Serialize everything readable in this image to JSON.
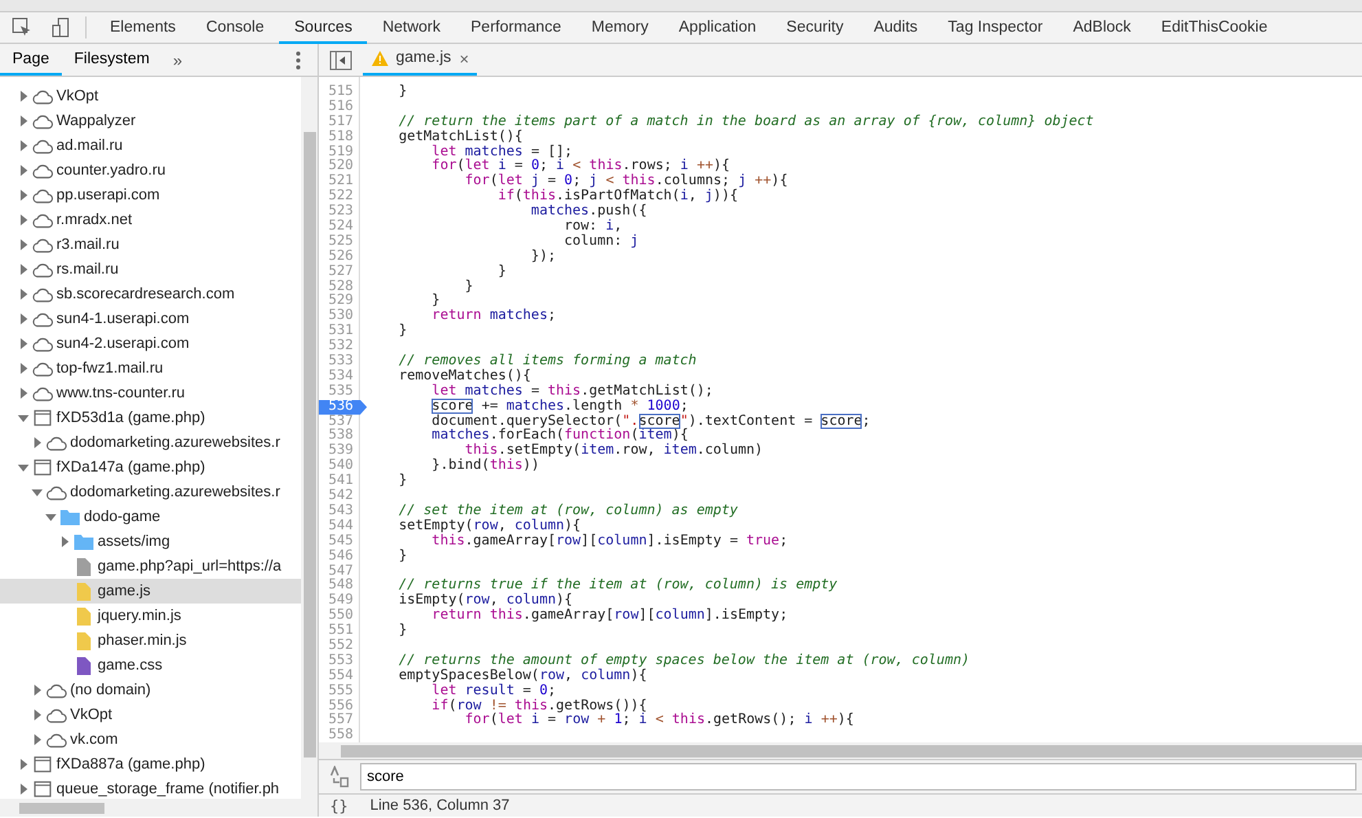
{
  "panel_tabs": [
    {
      "label": "Elements",
      "selected": false
    },
    {
      "label": "Console",
      "selected": false
    },
    {
      "label": "Sources",
      "selected": true
    },
    {
      "label": "Network",
      "selected": false
    },
    {
      "label": "Performance",
      "selected": false
    },
    {
      "label": "Memory",
      "selected": false
    },
    {
      "label": "Application",
      "selected": false
    },
    {
      "label": "Security",
      "selected": false
    },
    {
      "label": "Audits",
      "selected": false
    },
    {
      "label": "Tag Inspector",
      "selected": false
    },
    {
      "label": "AdBlock",
      "selected": false
    },
    {
      "label": "EditThisCookie",
      "selected": false
    }
  ],
  "navigator": {
    "tabs": [
      {
        "label": "Page",
        "selected": true
      },
      {
        "label": "Filesystem",
        "selected": false
      }
    ],
    "more": "»",
    "tree": [
      {
        "kind": "cloud",
        "label": "VkOpt",
        "expanded": false,
        "selected": false
      },
      {
        "kind": "cloud",
        "label": "Wappalyzer",
        "expanded": false,
        "selected": false
      },
      {
        "kind": "cloud",
        "label": "ad.mail.ru",
        "expanded": false,
        "selected": false
      },
      {
        "kind": "cloud",
        "label": "counter.yadro.ru",
        "expanded": false,
        "selected": false
      },
      {
        "kind": "cloud",
        "label": "pp.userapi.com",
        "expanded": false,
        "selected": false
      },
      {
        "kind": "cloud",
        "label": "r.mradx.net",
        "expanded": false,
        "selected": false
      },
      {
        "kind": "cloud",
        "label": "r3.mail.ru",
        "expanded": false,
        "selected": false
      },
      {
        "kind": "cloud",
        "label": "rs.mail.ru",
        "expanded": false,
        "selected": false
      },
      {
        "kind": "cloud",
        "label": "sb.scorecardresearch.com",
        "expanded": false,
        "selected": false
      },
      {
        "kind": "cloud",
        "label": "sun4-1.userapi.com",
        "expanded": false,
        "selected": false
      },
      {
        "kind": "cloud",
        "label": "sun4-2.userapi.com",
        "expanded": false,
        "selected": false
      },
      {
        "kind": "cloud",
        "label": "top-fwz1.mail.ru",
        "expanded": false,
        "selected": false
      },
      {
        "kind": "cloud",
        "label": "www.tns-counter.ru",
        "expanded": false,
        "selected": false
      },
      {
        "kind": "frame",
        "label": "fXD53d1a (game.php)",
        "expanded": true,
        "selected": false,
        "children": [
          {
            "kind": "cloud",
            "label": "dodomarketing.azurewebsites.r",
            "expanded": false,
            "selected": false
          }
        ]
      },
      {
        "kind": "frame",
        "label": "fXDa147a (game.php)",
        "expanded": true,
        "selected": false,
        "children": [
          {
            "kind": "cloud",
            "label": "dodomarketing.azurewebsites.r",
            "expanded": true,
            "selected": false,
            "children": [
              {
                "kind": "folder",
                "label": "dodo-game",
                "expanded": true,
                "selected": false,
                "children": [
                  {
                    "kind": "folder",
                    "label": "assets/img",
                    "expanded": false,
                    "selected": false
                  },
                  {
                    "kind": "file",
                    "label": "game.php?api_url=https://a",
                    "color": "#9e9e9e",
                    "selected": false
                  },
                  {
                    "kind": "file",
                    "label": "game.js",
                    "color": "#f0c94b",
                    "selected": true
                  },
                  {
                    "kind": "file",
                    "label": "jquery.min.js",
                    "color": "#f0c94b",
                    "selected": false
                  },
                  {
                    "kind": "file",
                    "label": "phaser.min.js",
                    "color": "#f0c94b",
                    "selected": false
                  },
                  {
                    "kind": "file",
                    "label": "game.css",
                    "color": "#7e57c2",
                    "selected": false
                  }
                ]
              }
            ]
          },
          {
            "kind": "cloud",
            "label": "(no domain)",
            "expanded": false,
            "selected": false
          },
          {
            "kind": "cloud",
            "label": "VkOpt",
            "expanded": false,
            "selected": false
          },
          {
            "kind": "cloud",
            "label": "vk.com",
            "expanded": false,
            "selected": false
          }
        ]
      },
      {
        "kind": "frame",
        "label": "fXDa887a (game.php)",
        "expanded": false,
        "selected": false
      },
      {
        "kind": "frame",
        "label": "queue_storage_frame (notifier.ph",
        "expanded": false,
        "selected": false
      }
    ]
  },
  "editor": {
    "tab": {
      "label": "game.js",
      "close": "×"
    },
    "lines": [
      {
        "number": "515",
        "breakpoint": false,
        "tokens": [
          {
            "kind": "plain",
            "text": "    }"
          }
        ]
      },
      {
        "number": "516",
        "breakpoint": false
      },
      {
        "number": "517",
        "breakpoint": false,
        "tokens": [
          {
            "kind": "comment",
            "text": "    // return the items part of a match in the board as an array of {row, column} object"
          }
        ]
      },
      {
        "number": "518",
        "breakpoint": false,
        "tokens": [
          {
            "kind": "plain",
            "text": "    getMatchList(){"
          }
        ]
      },
      {
        "number": "519",
        "breakpoint": false,
        "tokens": [
          {
            "kind": "keyword",
            "text": "        let"
          },
          {
            "kind": "variable",
            "text": " matches"
          },
          {
            "kind": "plain",
            "text": " = [];"
          }
        ]
      },
      {
        "number": "520",
        "breakpoint": false,
        "tokens": [
          {
            "kind": "keyword",
            "text": "        for"
          },
          {
            "kind": "plain",
            "text": "("
          },
          {
            "kind": "keyword",
            "text": "let"
          },
          {
            "kind": "variable",
            "text": " i"
          },
          {
            "kind": "plain",
            "text": " = "
          },
          {
            "kind": "number",
            "text": "0"
          },
          {
            "kind": "plain",
            "text": "; "
          },
          {
            "kind": "variable",
            "text": "i"
          },
          {
            "kind": "operator",
            "text": " <"
          },
          {
            "kind": "keyword",
            "text": " this"
          },
          {
            "kind": "plain",
            "text": ".rows; "
          },
          {
            "kind": "variable",
            "text": "i"
          },
          {
            "kind": "operator",
            "text": " ++"
          },
          {
            "kind": "plain",
            "text": "){"
          }
        ]
      },
      {
        "number": "521",
        "breakpoint": false,
        "tokens": [
          {
            "kind": "keyword",
            "text": "            for"
          },
          {
            "kind": "plain",
            "text": "("
          },
          {
            "kind": "keyword",
            "text": "let"
          },
          {
            "kind": "variable",
            "text": " j"
          },
          {
            "kind": "plain",
            "text": " = "
          },
          {
            "kind": "number",
            "text": "0"
          },
          {
            "kind": "plain",
            "text": "; "
          },
          {
            "kind": "variable",
            "text": "j"
          },
          {
            "kind": "operator",
            "text": " <"
          },
          {
            "kind": "keyword",
            "text": " this"
          },
          {
            "kind": "plain",
            "text": ".columns; "
          },
          {
            "kind": "variable",
            "text": "j"
          },
          {
            "kind": "operator",
            "text": " ++"
          },
          {
            "kind": "plain",
            "text": "){"
          }
        ]
      },
      {
        "number": "522",
        "breakpoint": false,
        "tokens": [
          {
            "kind": "keyword",
            "text": "                if"
          },
          {
            "kind": "plain",
            "text": "("
          },
          {
            "kind": "keyword",
            "text": "this"
          },
          {
            "kind": "plain",
            "text": ".isPartOfMatch("
          },
          {
            "kind": "variable",
            "text": "i"
          },
          {
            "kind": "plain",
            "text": ", "
          },
          {
            "kind": "variable",
            "text": "j"
          },
          {
            "kind": "plain",
            "text": ")){"
          }
        ]
      },
      {
        "number": "523",
        "breakpoint": false,
        "tokens": [
          {
            "kind": "variable",
            "text": "                    matches"
          },
          {
            "kind": "plain",
            "text": ".push({"
          }
        ]
      },
      {
        "number": "524",
        "breakpoint": false,
        "tokens": [
          {
            "kind": "plain",
            "text": "                        row: "
          },
          {
            "kind": "variable",
            "text": "i"
          },
          {
            "kind": "plain",
            "text": ","
          }
        ]
      },
      {
        "number": "525",
        "breakpoint": false,
        "tokens": [
          {
            "kind": "plain",
            "text": "                        column: "
          },
          {
            "kind": "variable",
            "text": "j"
          }
        ]
      },
      {
        "number": "526",
        "breakpoint": false,
        "tokens": [
          {
            "kind": "plain",
            "text": "                    });"
          }
        ]
      },
      {
        "number": "527",
        "breakpoint": false,
        "tokens": [
          {
            "kind": "plain",
            "text": "                }"
          }
        ]
      },
      {
        "number": "528",
        "breakpoint": false,
        "tokens": [
          {
            "kind": "plain",
            "text": "            }"
          }
        ]
      },
      {
        "number": "529",
        "breakpoint": false,
        "tokens": [
          {
            "kind": "plain",
            "text": "        }"
          }
        ]
      },
      {
        "number": "530",
        "breakpoint": false,
        "tokens": [
          {
            "kind": "keyword",
            "text": "        return"
          },
          {
            "kind": "variable",
            "text": " matches"
          },
          {
            "kind": "plain",
            "text": ";"
          }
        ]
      },
      {
        "number": "531",
        "breakpoint": false,
        "tokens": [
          {
            "kind": "plain",
            "text": "    }"
          }
        ]
      },
      {
        "number": "532",
        "breakpoint": false
      },
      {
        "number": "533",
        "breakpoint": false,
        "tokens": [
          {
            "kind": "comment",
            "text": "    // removes all items forming a match"
          }
        ]
      },
      {
        "number": "534",
        "breakpoint": false,
        "tokens": [
          {
            "kind": "plain",
            "text": "    removeMatches(){"
          }
        ]
      },
      {
        "number": "535",
        "breakpoint": false,
        "tokens": [
          {
            "kind": "keyword",
            "text": "        let"
          },
          {
            "kind": "variable",
            "text": " matches"
          },
          {
            "kind": "plain",
            "text": " = "
          },
          {
            "kind": "keyword",
            "text": "this"
          },
          {
            "kind": "plain",
            "text": ".getMatchList();"
          }
        ]
      },
      {
        "number": "536",
        "breakpoint": true,
        "tokens": [
          {
            "kind": "match",
            "text": "        score"
          },
          {
            "kind": "plain",
            "text": " += "
          },
          {
            "kind": "variable",
            "text": "matches"
          },
          {
            "kind": "plain",
            "text": ".length "
          },
          {
            "kind": "operator",
            "text": "*"
          },
          {
            "kind": "number",
            "text": " 1000"
          },
          {
            "kind": "plain",
            "text": ";"
          }
        ]
      },
      {
        "number": "537",
        "breakpoint": false,
        "tokens": [
          {
            "kind": "plain",
            "text": "        document.querySelector("
          },
          {
            "kind": "string",
            "text": "\"."
          },
          {
            "kind": "match",
            "text": "score"
          },
          {
            "kind": "string",
            "text": "\""
          },
          {
            "kind": "plain",
            "text": ").textContent = "
          },
          {
            "kind": "match",
            "text": "score"
          },
          {
            "kind": "plain",
            "text": ";"
          }
        ]
      },
      {
        "number": "538",
        "breakpoint": false,
        "tokens": [
          {
            "kind": "variable",
            "text": "        matches"
          },
          {
            "kind": "plain",
            "text": ".forEach("
          },
          {
            "kind": "keyword",
            "text": "function"
          },
          {
            "kind": "plain",
            "text": "("
          },
          {
            "kind": "variable",
            "text": "item"
          },
          {
            "kind": "plain",
            "text": "){"
          }
        ]
      },
      {
        "number": "539",
        "breakpoint": false,
        "tokens": [
          {
            "kind": "keyword",
            "text": "            this"
          },
          {
            "kind": "plain",
            "text": ".setEmpty("
          },
          {
            "kind": "variable",
            "text": "item"
          },
          {
            "kind": "plain",
            "text": ".row, "
          },
          {
            "kind": "variable",
            "text": "item"
          },
          {
            "kind": "plain",
            "text": ".column)"
          }
        ]
      },
      {
        "number": "540",
        "breakpoint": false,
        "tokens": [
          {
            "kind": "plain",
            "text": "        }.bind("
          },
          {
            "kind": "keyword",
            "text": "this"
          },
          {
            "kind": "plain",
            "text": "))"
          }
        ]
      },
      {
        "number": "541",
        "breakpoint": false,
        "tokens": [
          {
            "kind": "plain",
            "text": "    }"
          }
        ]
      },
      {
        "number": "542",
        "breakpoint": false
      },
      {
        "number": "543",
        "breakpoint": false,
        "tokens": [
          {
            "kind": "comment",
            "text": "    // set the item at (row, column) as empty"
          }
        ]
      },
      {
        "number": "544",
        "breakpoint": false,
        "tokens": [
          {
            "kind": "plain",
            "text": "    setEmpty("
          },
          {
            "kind": "variable",
            "text": "row"
          },
          {
            "kind": "plain",
            "text": ", "
          },
          {
            "kind": "variable",
            "text": "column"
          },
          {
            "kind": "plain",
            "text": "){"
          }
        ]
      },
      {
        "number": "545",
        "breakpoint": false,
        "tokens": [
          {
            "kind": "keyword",
            "text": "        this"
          },
          {
            "kind": "plain",
            "text": ".gameArray["
          },
          {
            "kind": "variable",
            "text": "row"
          },
          {
            "kind": "plain",
            "text": "]["
          },
          {
            "kind": "variable",
            "text": "column"
          },
          {
            "kind": "plain",
            "text": "].isEmpty = "
          },
          {
            "kind": "keyword",
            "text": "true"
          },
          {
            "kind": "plain",
            "text": ";"
          }
        ]
      },
      {
        "number": "546",
        "breakpoint": false,
        "tokens": [
          {
            "kind": "plain",
            "text": "    }"
          }
        ]
      },
      {
        "number": "547",
        "breakpoint": false
      },
      {
        "number": "548",
        "breakpoint": false,
        "tokens": [
          {
            "kind": "comment",
            "text": "    // returns true if the item at (row, column) is empty"
          }
        ]
      },
      {
        "number": "549",
        "breakpoint": false,
        "tokens": [
          {
            "kind": "plain",
            "text": "    isEmpty("
          },
          {
            "kind": "variable",
            "text": "row"
          },
          {
            "kind": "plain",
            "text": ", "
          },
          {
            "kind": "variable",
            "text": "column"
          },
          {
            "kind": "plain",
            "text": "){"
          }
        ]
      },
      {
        "number": "550",
        "breakpoint": false,
        "tokens": [
          {
            "kind": "keyword",
            "text": "        return"
          },
          {
            "kind": "keyword",
            "text": " this"
          },
          {
            "kind": "plain",
            "text": ".gameArray["
          },
          {
            "kind": "variable",
            "text": "row"
          },
          {
            "kind": "plain",
            "text": "]["
          },
          {
            "kind": "variable",
            "text": "column"
          },
          {
            "kind": "plain",
            "text": "].isEmpty;"
          }
        ]
      },
      {
        "number": "551",
        "breakpoint": false,
        "tokens": [
          {
            "kind": "plain",
            "text": "    }"
          }
        ]
      },
      {
        "number": "552",
        "breakpoint": false
      },
      {
        "number": "553",
        "breakpoint": false,
        "tokens": [
          {
            "kind": "comment",
            "text": "    // returns the amount of empty spaces below the item at (row, column)"
          }
        ]
      },
      {
        "number": "554",
        "breakpoint": false,
        "tokens": [
          {
            "kind": "plain",
            "text": "    emptySpacesBelow("
          },
          {
            "kind": "variable",
            "text": "row"
          },
          {
            "kind": "plain",
            "text": ", "
          },
          {
            "kind": "variable",
            "text": "column"
          },
          {
            "kind": "plain",
            "text": "){"
          }
        ]
      },
      {
        "number": "555",
        "breakpoint": false,
        "tokens": [
          {
            "kind": "keyword",
            "text": "        let"
          },
          {
            "kind": "variable",
            "text": " result"
          },
          {
            "kind": "plain",
            "text": " = "
          },
          {
            "kind": "number",
            "text": "0"
          },
          {
            "kind": "plain",
            "text": ";"
          }
        ]
      },
      {
        "number": "556",
        "breakpoint": false,
        "tokens": [
          {
            "kind": "keyword",
            "text": "        if"
          },
          {
            "kind": "plain",
            "text": "("
          },
          {
            "kind": "variable",
            "text": "row"
          },
          {
            "kind": "operator",
            "text": " !="
          },
          {
            "kind": "keyword",
            "text": " this"
          },
          {
            "kind": "plain",
            "text": ".getRows()){"
          }
        ]
      },
      {
        "number": "557",
        "breakpoint": false,
        "tokens": [
          {
            "kind": "keyword",
            "text": "            for"
          },
          {
            "kind": "plain",
            "text": "("
          },
          {
            "kind": "keyword",
            "text": "let"
          },
          {
            "kind": "variable",
            "text": " i"
          },
          {
            "kind": "plain",
            "text": " = "
          },
          {
            "kind": "variable",
            "text": "row"
          },
          {
            "kind": "operator",
            "text": " +"
          },
          {
            "kind": "number",
            "text": " 1"
          },
          {
            "kind": "plain",
            "text": "; "
          },
          {
            "kind": "variable",
            "text": "i"
          },
          {
            "kind": "operator",
            "text": " <"
          },
          {
            "kind": "keyword",
            "text": " this"
          },
          {
            "kind": "plain",
            "text": ".getRows(); "
          },
          {
            "kind": "variable",
            "text": "i"
          },
          {
            "kind": "operator",
            "text": " ++"
          },
          {
            "kind": "plain",
            "text": "){"
          }
        ]
      },
      {
        "number": "558",
        "breakpoint": false
      }
    ],
    "search": {
      "value": "score"
    },
    "status_bar": {
      "format_button": "{}",
      "position": "Line 536, Column 37"
    }
  }
}
